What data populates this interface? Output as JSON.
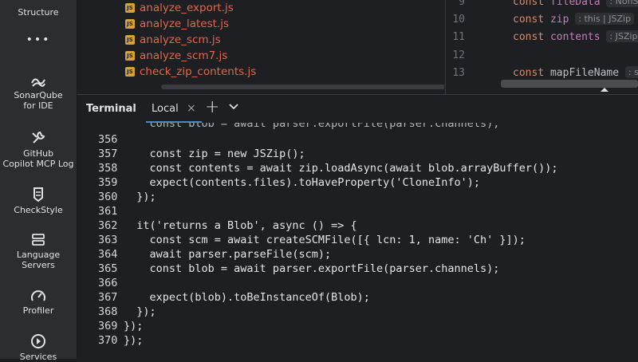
{
  "toolstrip": {
    "items": [
      {
        "label": "Structure",
        "icon": "structure-icon"
      },
      {
        "label": "•••",
        "icon": "more-icon"
      },
      {
        "label": "SonarQube\nfor IDE",
        "icon": "sonarqube-icon"
      },
      {
        "label": "GitHub\nCopilot MCP Log",
        "icon": "wrench-icon"
      },
      {
        "label": "CheckStyle",
        "icon": "checkstyle-icon"
      },
      {
        "label": "Language\nServers",
        "icon": "servers-icon"
      },
      {
        "label": "Profiler",
        "icon": "profiler-icon"
      },
      {
        "label": "Services",
        "icon": "services-icon"
      }
    ]
  },
  "project": {
    "files": [
      {
        "name": "analyze_export.js",
        "badge": "JS"
      },
      {
        "name": "analyze_latest.js",
        "badge": "JS"
      },
      {
        "name": "analyze_scm.js",
        "badge": "JS"
      },
      {
        "name": "analyze_scm7.js",
        "badge": "JS"
      },
      {
        "name": "check_zip_contents.js",
        "badge": "JS"
      }
    ]
  },
  "editor": {
    "lines": [
      {
        "num": "9",
        "kw": "const",
        "name": "fileData",
        "hint": ": NonSt"
      },
      {
        "num": "10",
        "kw": "const",
        "name": "zip",
        "hint": ": this | JSZip"
      },
      {
        "num": "11",
        "kw": "const",
        "name": "contents",
        "hint": ": JSZip"
      },
      {
        "num": "12",
        "kw": "",
        "name": "",
        "hint": ""
      },
      {
        "num": "13",
        "kw": "const",
        "name": "mapFileName",
        "hint": ": st"
      }
    ]
  },
  "terminal": {
    "title": "Terminal",
    "tab_label": "Local",
    "close_glyph": "×",
    "add_glyph": "+",
    "more_glyph": "⌄",
    "lines": [
      {
        "num": "",
        "code": "    const blob = await parser.exportFile(parser.channels);"
      },
      {
        "num": "356",
        "code": ""
      },
      {
        "num": "357",
        "code": "    const zip = new JSZip();"
      },
      {
        "num": "358",
        "code": "    const contents = await zip.loadAsync(await blob.arrayBuffer());"
      },
      {
        "num": "359",
        "code": "    expect(contents.files).toHaveProperty('CloneInfo');"
      },
      {
        "num": "360",
        "code": "  });"
      },
      {
        "num": "361",
        "code": ""
      },
      {
        "num": "362",
        "code": "  it('returns a Blob', async () => {"
      },
      {
        "num": "363",
        "code": "    const scm = await createSCMFile([{ lcn: 1, name: 'Ch' }]);"
      },
      {
        "num": "364",
        "code": "    await parser.parseFile(scm);"
      },
      {
        "num": "365",
        "code": "    const blob = await parser.exportFile(parser.channels);"
      },
      {
        "num": "366",
        "code": ""
      },
      {
        "num": "367",
        "code": "    expect(blob).toBeInstanceOf(Blob);"
      },
      {
        "num": "368",
        "code": "  });"
      },
      {
        "num": "369",
        "code": "});"
      },
      {
        "num": "370",
        "code": "});"
      }
    ]
  },
  "colors": {
    "file_name": "#e8654b",
    "keyword": "#cf8e6d",
    "variable": "#c77dbb",
    "accent": "#4a88c7"
  }
}
